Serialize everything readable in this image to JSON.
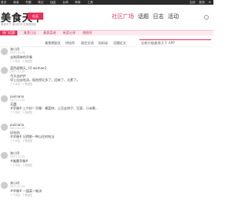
{
  "topbar": {
    "nav": [
      "首页",
      "食谱",
      "专题",
      "笔记",
      "社区",
      "台湾",
      "榜单",
      "工具"
    ],
    "active_index": 4,
    "right": [
      "注册",
      "登录",
      "⊕"
    ]
  },
  "header": {
    "logo": "美食天下",
    "logo_sub": "美食天下 最大的中文美食网站",
    "badge": "社区",
    "nav": [
      "社区广场",
      "话题",
      "日志",
      "活动"
    ],
    "active_index": 0
  },
  "redbar": {
    "tabs": [
      "热门话题",
      "美食日志",
      "美食菜谱",
      "新菜分享",
      "晒图秀"
    ],
    "active_index": 0
  },
  "subtabs": [
    "美食晒厨艺",
    "烘焙秀",
    "厨艺交流",
    "妈妈谈",
    "话题征文"
  ],
  "sidebar": {
    "ad": "全新升级美食天下 APP"
  },
  "posts": [
    {
      "name": "奔小玲",
      "sub": "2017-11-25",
      "body": "走啦简单的早餐",
      "meta": "7 个评论 · 3 条回复"
    },
    {
      "name": "蓝色星期天_ IO woman2",
      "sub": "2017-11-25",
      "body": "今天去护护",
      "body2": "早上出去吃汤，饭吃得太多了，回来了，太累了。",
      "meta": "7 个评论 · 3 条回复"
    },
    {
      "name": "puiinana",
      "sub": "2017-11-25",
      "body": "芳蕾",
      "body2": "#早餐# 上午好！早餐：酱菜饼，土豆丝饼子、豆浆，小米粥...",
      "meta": "7 个评论 · 3 条回复"
    },
    {
      "name": "puiinana",
      "sub": "2017-11-25",
      "body": "好吃的",
      "body2": "#早餐# 记得那一种以往的吃法",
      "meta": "7 个评论 · 3 条回复"
    },
    {
      "name": "奔小玲",
      "sub": "2017-11-25",
      "body": "#美晨早餐#",
      "meta": "7 个评论 · 3 条回复"
    },
    {
      "name": "奔小玲",
      "sub": "2017-11-25",
      "body": "#早餐# 一盘菜一碗汤",
      "meta": "7 个评论 · 3 条回复"
    }
  ]
}
